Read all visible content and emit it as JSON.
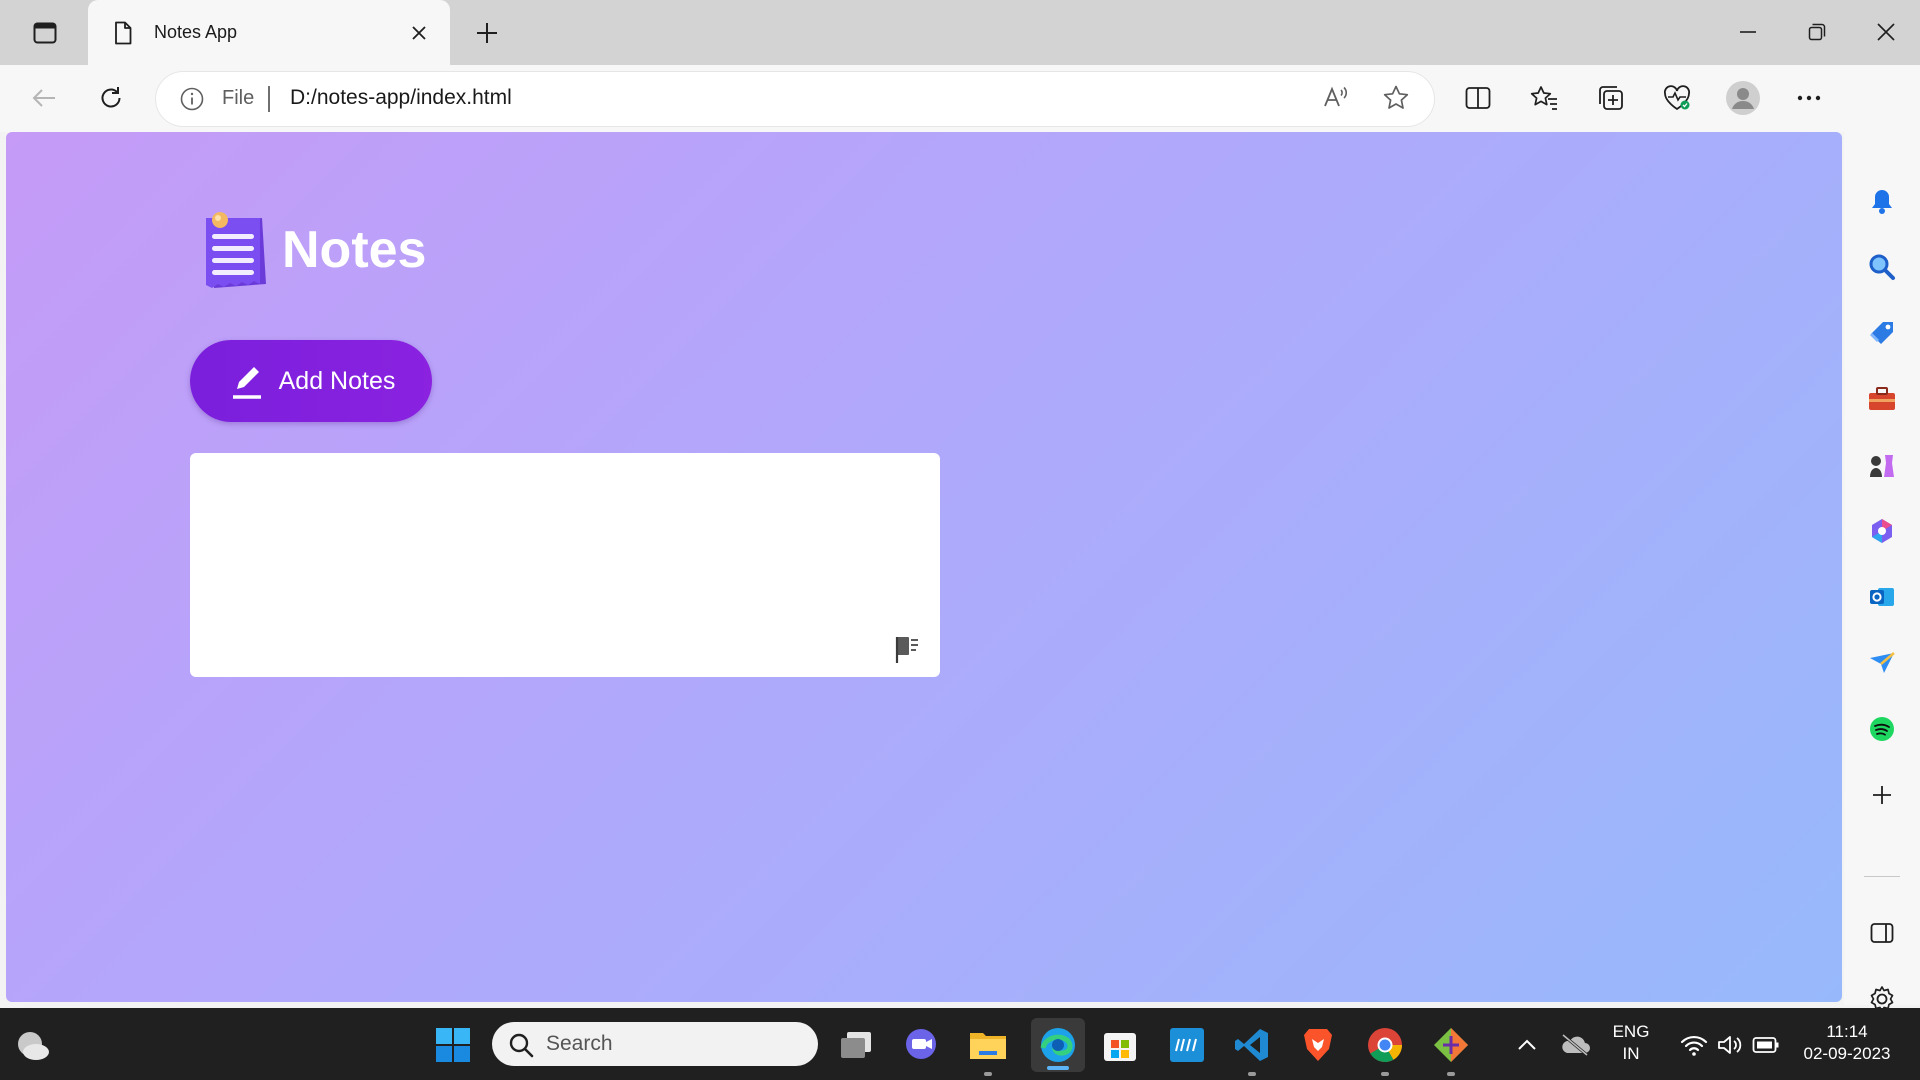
{
  "browser": {
    "tab": {
      "title": "Notes App"
    },
    "address": {
      "scheme_label": "File",
      "url": "D:/notes-app/index.html"
    }
  },
  "page": {
    "app_title": "Notes",
    "add_button_label": "Add Notes",
    "notes": [
      {
        "text": ""
      }
    ]
  },
  "taskbar": {
    "search_label": "Search",
    "language_line1": "ENG",
    "language_line2": "IN",
    "time": "11:14",
    "date": "02-09-2023"
  },
  "colors": {
    "accent_button": "#7a1fdc",
    "page_gradient_start": "#c59bf7",
    "page_gradient_end": "#97b9fb",
    "taskbar": "#202020"
  },
  "icons": {
    "tab_strip": [
      "tab-actions-icon",
      "page-file-icon",
      "close-icon",
      "plus-icon"
    ],
    "toolbar": [
      "back-arrow-icon",
      "refresh-icon",
      "info-icon",
      "read-aloud-icon",
      "star-icon",
      "split-screen-icon",
      "favorites-icon",
      "collections-icon",
      "browser-essentials-icon",
      "profile-icon",
      "more-icon",
      "bing-copilot-icon"
    ],
    "sidebar": [
      "bell-icon",
      "search-icon",
      "shopping-tag-icon",
      "tools-icon",
      "games-icon",
      "microsoft365-icon",
      "outlook-icon",
      "send-icon",
      "spotify-icon",
      "plus-icon",
      "sidebar-toggle-icon",
      "settings-icon"
    ],
    "taskbar": [
      "weather-icon",
      "windows-start-icon",
      "task-view-icon",
      "chat-icon",
      "file-explorer-icon",
      "edge-icon",
      "store-icon",
      "myhp-icon",
      "vscode-icon",
      "brave-icon",
      "chrome-icon",
      "git-icon",
      "chevron-up-icon",
      "cloud-off-icon",
      "wifi-icon",
      "volume-icon",
      "battery-icon"
    ]
  }
}
